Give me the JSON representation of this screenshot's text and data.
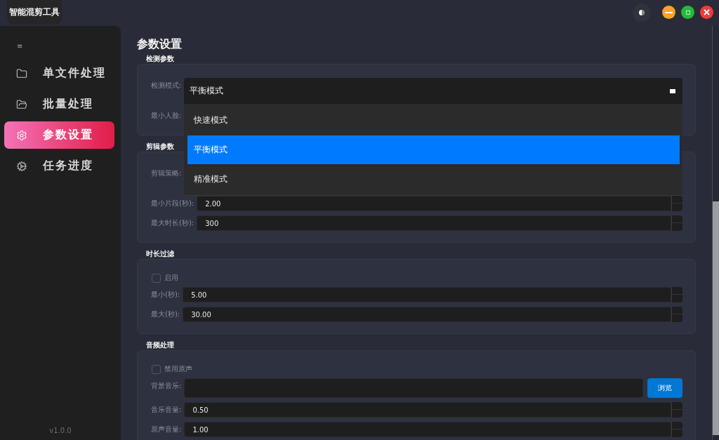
{
  "app_title": "智能混剪工具",
  "sidebar": {
    "menu_glyph": "≡",
    "items": [
      {
        "label": "单文件处理",
        "selected": false
      },
      {
        "label": "批量处理",
        "selected": false
      },
      {
        "label": "参数设置",
        "selected": true
      },
      {
        "label": "任务进度",
        "selected": false
      }
    ],
    "version": "v1.0.0"
  },
  "page_title": "参数设置",
  "groups": [
    {
      "title": "检测参数",
      "rows": [
        {
          "kind": "combo",
          "label": "检测模式:",
          "value": "平衡模式",
          "expanded": true,
          "options": [
            {
              "label": "快速模式",
              "selected": false
            },
            {
              "label": "平衡模式",
              "selected": true
            },
            {
              "label": "精准模式",
              "selected": false
            }
          ]
        },
        {
          "kind": "spin",
          "label": "最小人脸:"
        }
      ]
    },
    {
      "title": "剪辑参数",
      "rows": [
        {
          "kind": "combo",
          "label": "剪辑策略:"
        },
        {
          "kind": "spin",
          "label": "最小片段(秒):",
          "value": "2.00"
        },
        {
          "kind": "spin",
          "label": "最大时长(秒):",
          "value": "300"
        }
      ]
    },
    {
      "title": "时长过滤",
      "rows": [
        {
          "kind": "checkbox",
          "label": "启用",
          "checked": false
        },
        {
          "kind": "spin",
          "label": "最小(秒):",
          "value": "5.00"
        },
        {
          "kind": "spin",
          "label": "最大(秒):",
          "value": "30.00"
        }
      ]
    },
    {
      "title": "音频处理",
      "rows": [
        {
          "kind": "checkbox",
          "label": "禁用原声",
          "checked": false
        },
        {
          "kind": "file",
          "label": "背景音乐:",
          "button": "浏览"
        },
        {
          "kind": "spin",
          "label": "音乐音量:",
          "value": "0.50"
        },
        {
          "kind": "spin",
          "label": "原声音量:",
          "value": "1.00"
        }
      ]
    }
  ]
}
